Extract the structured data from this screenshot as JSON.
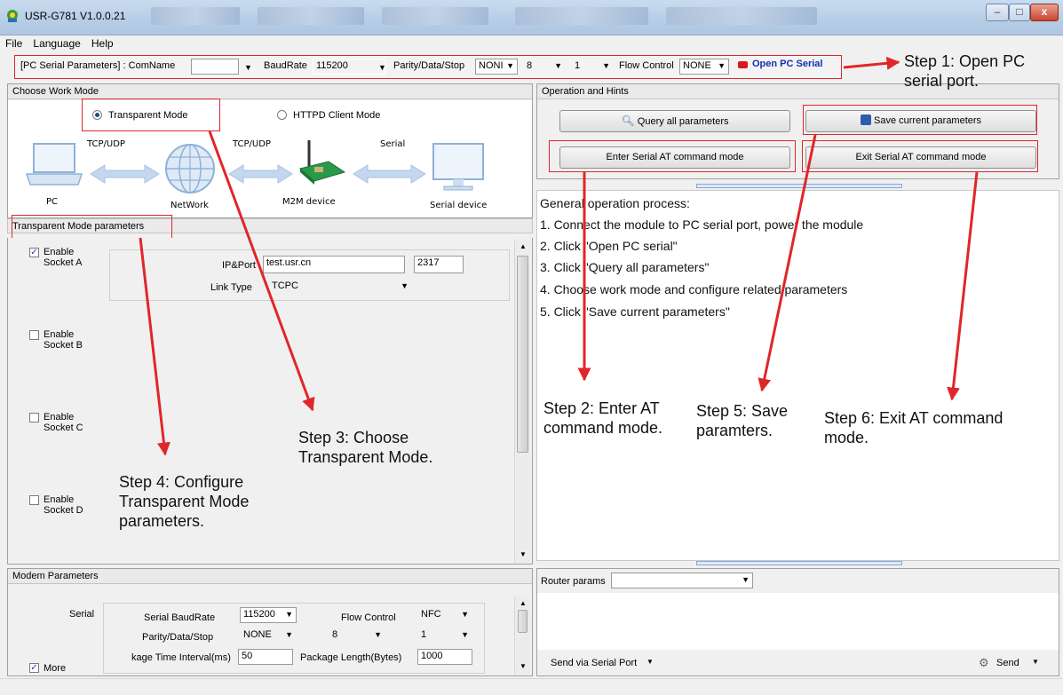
{
  "window": {
    "title": "USR-G781 V1.0.0.21",
    "min_label": "–",
    "max_label": "□",
    "close_label": "x"
  },
  "menu": [
    "File",
    "Language",
    "Help"
  ],
  "serial": {
    "prefix": "[PC Serial Parameters] : ComName",
    "comname_value": "",
    "baud_label": "BaudRate",
    "baud_value": "115200",
    "parity_label": "Parity/Data/Stop",
    "parity_value": "NONI",
    "data_value": "8",
    "stop_value": "1",
    "flow_label": "Flow Control",
    "flow_value": "NONE",
    "open_label": "Open PC Serial"
  },
  "work_mode": {
    "header": "Choose Work Mode",
    "transparent_label": "Transparent Mode",
    "httpd_label": "HTTPD Client Mode",
    "diagram": {
      "pc": "PC",
      "network": "NetWork",
      "m2m": "M2M device",
      "serial_device": "Serial device",
      "link1": "TCP/UDP",
      "link2": "TCP/UDP",
      "link3": "Serial"
    }
  },
  "transparent_params": {
    "header": "Transparent Mode parameters",
    "socket_a": {
      "line1": "Enable",
      "line2": "Socket A",
      "checked": true
    },
    "socket_b": {
      "line1": "Enable",
      "line2": "Socket B",
      "checked": false
    },
    "socket_c": {
      "line1": "Enable",
      "line2": "Socket C",
      "checked": false
    },
    "socket_d": {
      "line1": "Enable",
      "line2": "Socket D",
      "checked": false
    },
    "ip_port_label": "IP&Port",
    "ip_value": "test.usr.cn",
    "port_value": "2317",
    "link_type_label": "Link Type",
    "link_type_value": "TCPC"
  },
  "modem": {
    "header": "Modem Parameters",
    "serial_label": "Serial",
    "baud_label": "Serial BaudRate",
    "baud_value": "115200",
    "flow_label": "Flow Control",
    "flow_value": "NFC",
    "parity_label": "Parity/Data/Stop",
    "parity_value": "NONE",
    "data_value": "8",
    "stop_value": "1",
    "interval_label": "kage Time Interval(ms)",
    "interval_value": "50",
    "length_label": "Package Length(Bytes)",
    "length_value": "1000",
    "more_label": "More",
    "more_checked": true
  },
  "operation": {
    "header": "Operation and Hints",
    "query_label": "Query all parameters",
    "save_label": "Save current parameters",
    "enter_label": "Enter Serial AT command mode",
    "exit_label": "Exit Serial AT command mode"
  },
  "hints": [
    "General operation process:",
    "1. Connect the module to PC serial port, power the module",
    "2. Click \"Open PC serial\"",
    "3. Click \"Query all parameters\"",
    "4. Choose work mode and configure related parameters",
    "5. Click \"Save current parameters\""
  ],
  "router": {
    "label": "Router params",
    "value": "",
    "send_via_label": "Send via Serial Port",
    "send_label": "Send"
  },
  "annotations": {
    "step1": "Step 1: Open PC\nserial port.",
    "step2": "Step 2: Enter AT\ncommand mode.",
    "step3": "Step 3: Choose\nTransparent Mode.",
    "step4": "Step 4: Configure\nTransparent Mode\nparameters.",
    "step5": "Step 5: Save\nparamters.",
    "step6": "Step 6: Exit AT command\nmode."
  },
  "colors": {
    "annotation_red": "#e0262a",
    "open_serial_text": "#1530b0",
    "titlebar": "#b7cde6"
  }
}
